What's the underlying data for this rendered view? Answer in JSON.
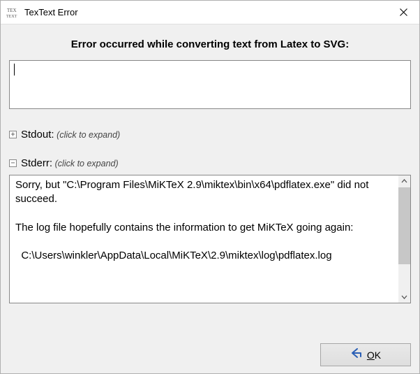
{
  "window": {
    "title": "TexText Error",
    "icon_label": "TexText"
  },
  "heading": "Error occurred while converting text from Latex to SVG:",
  "main_text": "",
  "stdout": {
    "label": "Stdout:",
    "hint": "(click to expand)",
    "expanded": false
  },
  "stderr": {
    "label": "Stderr:",
    "hint": "(click to expand)",
    "expanded": true,
    "content": "Sorry, but \"C:\\Program Files\\MiKTeX 2.9\\miktex\\bin\\x64\\pdflatex.exe\" did not succeed.\n\nThe log file hopefully contains the information to get MiKTeX going again:\n\n  C:\\Users\\winkler\\AppData\\Local\\MiKTeX\\2.9\\miktex\\log\\pdflatex.log"
  },
  "buttons": {
    "ok_prefix": "O",
    "ok_rest": "K"
  }
}
